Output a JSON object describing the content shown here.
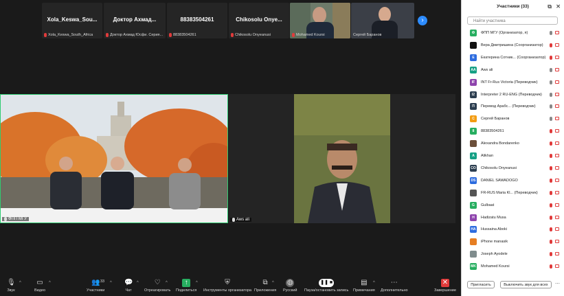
{
  "strip": {
    "tiles": [
      {
        "big": "Xola_Keswa_Sou...",
        "label": "Xola_Keswa_South_Africa"
      },
      {
        "big": "Доктор  Ахмад...",
        "label": "Доктор Ахмад Юсфи. Серия..."
      },
      {
        "big": "88383504261",
        "label": "88383504261"
      },
      {
        "big": "Chikosolu  Onye...",
        "label": "Chikosolu Onyeanusi"
      },
      {
        "big": "",
        "label": "Mohamed Koursi"
      },
      {
        "big": "",
        "label": "Сергей Баранов"
      }
    ],
    "next_icon": "chevron-right-icon"
  },
  "videos": {
    "left_label": "ФПП МГУ",
    "right_label": "Aws ali"
  },
  "toolbar": {
    "items": [
      {
        "label": "Звук",
        "icon": "microphone-icon"
      },
      {
        "label": "Видео",
        "icon": "camera-icon"
      },
      {
        "label": "Участники",
        "icon": "participants-icon",
        "count": "33"
      },
      {
        "label": "Чат",
        "icon": "chat-icon"
      },
      {
        "label": "Отреагировать",
        "icon": "heart-icon"
      },
      {
        "label": "Поделиться",
        "icon": "share-icon"
      },
      {
        "label": "Инструменты организатора",
        "icon": "shield-icon"
      },
      {
        "label": "Приложения",
        "icon": "apps-icon"
      },
      {
        "label": "Русский",
        "icon": "globe-icon"
      },
      {
        "label": "Пауза/остановить запись",
        "icon": "pause-icon"
      },
      {
        "label": "Примечания",
        "icon": "notes-icon"
      },
      {
        "label": "Дополнительно",
        "icon": "more-icon"
      },
      {
        "label": "Завершение",
        "icon": "end-icon"
      }
    ]
  },
  "panel": {
    "title": "Участники (33)",
    "search_placeholder": "Найти участника",
    "participants": [
      {
        "initials": "Ф",
        "color": "#27ae60",
        "name": "ФПП МГУ (Организатор, я)",
        "mic": "on"
      },
      {
        "initials": "",
        "color": "#111111",
        "name": "Вера Дмитришина (Соорганизатор)",
        "mic": "off"
      },
      {
        "initials": "Е",
        "color": "#2d6cdf",
        "name": "Екатерина Сотник... (Соорганизатор)",
        "mic": "off"
      },
      {
        "initials": "AA",
        "color": "#16a085",
        "name": "Aws ali",
        "mic": "on"
      },
      {
        "initials": "IF",
        "color": "#8e44ad",
        "name": "INT Fr-Rus Victoria (Переводчик)",
        "mic": "on"
      },
      {
        "initials": "I2",
        "color": "#2c3e50",
        "name": "Interpreter 2 RU-ENG (Переводчик)",
        "mic": "on"
      },
      {
        "initials": "П",
        "color": "#2c3e50",
        "name": "Перевод Арабс... (Переводчик)",
        "mic": "on"
      },
      {
        "initials": "С",
        "color": "#f39c12",
        "name": "Сергей Баранов",
        "mic": "on"
      },
      {
        "initials": "8",
        "color": "#27ae60",
        "name": "88383504261",
        "mic": "off"
      },
      {
        "initials": "",
        "color": "#6b4f3a",
        "name": "Alexandra Bondarenko",
        "mic": "off"
      },
      {
        "initials": "A",
        "color": "#16a085",
        "name": "Alikhan",
        "mic": "off"
      },
      {
        "initials": "CO",
        "color": "#2c3e50",
        "name": "Chikosolu Onyeanusi",
        "mic": "off"
      },
      {
        "initials": "DS",
        "color": "#2d6cdf",
        "name": "DANIEL SAWADOGO",
        "mic": "off"
      },
      {
        "initials": "",
        "color": "#555555",
        "name": "FR-RUS Maria Kl... (Переводчик)",
        "mic": "off"
      },
      {
        "initials": "G",
        "color": "#27ae60",
        "name": "Gulbaat",
        "mic": "off"
      },
      {
        "initials": "H",
        "color": "#8e44ad",
        "name": "Hadizatu Musa",
        "mic": "off"
      },
      {
        "initials": "HA",
        "color": "#2d6cdf",
        "name": "Hussaina Aboki",
        "mic": "off"
      },
      {
        "initials": "",
        "color": "#e67e22",
        "name": "iPhone manasik",
        "mic": "off"
      },
      {
        "initials": "",
        "color": "#7f8c8d",
        "name": "Joseph Ayodele",
        "mic": "off"
      },
      {
        "initials": "MK",
        "color": "#27ae60",
        "name": "Mohamed Koursi",
        "mic": "off"
      }
    ],
    "invite_label": "Пригласить",
    "mute_all_label": "Выключить звук для всех"
  }
}
